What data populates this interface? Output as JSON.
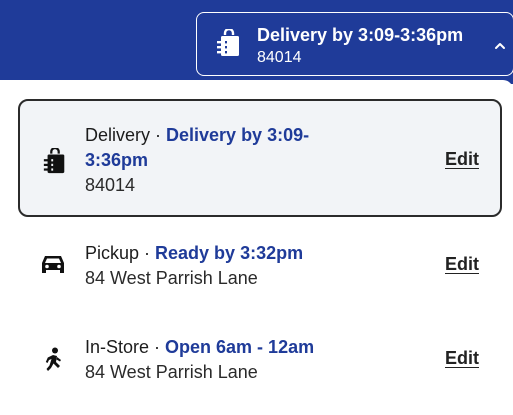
{
  "header": {
    "trigger": {
      "title": "Delivery by 3:09-3:36pm",
      "zip": "84014",
      "icon": "shopping-bag-icon",
      "chevron": "chevron-up-icon"
    }
  },
  "options": [
    {
      "id": "delivery",
      "name": "Delivery",
      "separator": " · ",
      "status_line1": "Delivery by 3:09-",
      "status_line2": "3:36pm",
      "subtext": "84014",
      "edit_label": "Edit",
      "icon": "shopping-bag-icon",
      "selected": true
    },
    {
      "id": "pickup",
      "name": "Pickup",
      "separator": " · ",
      "status": "Ready by 3:32pm",
      "subtext": "84 West Parrish Lane",
      "edit_label": "Edit",
      "icon": "car-icon",
      "selected": false
    },
    {
      "id": "in-store",
      "name": "In-Store",
      "separator": " · ",
      "status": "Open 6am - 12am",
      "subtext": "84 West Parrish Lane",
      "edit_label": "Edit",
      "icon": "walking-person-icon",
      "selected": false
    }
  ],
  "colors": {
    "brand_blue": "#1f3b99",
    "selected_bg": "#f2f4f7",
    "text": "#1c1c1c"
  }
}
